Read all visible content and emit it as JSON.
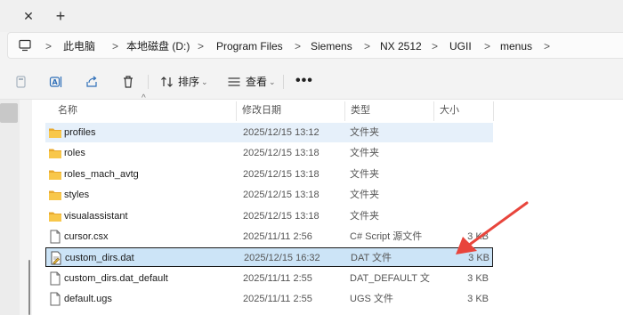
{
  "tabstrip": {
    "close_glyph": "✕",
    "new_tab_glyph": "+"
  },
  "address": {
    "crumbs": [
      "此电脑",
      "本地磁盘 (D:)",
      "Program Files",
      "Siemens",
      "NX 2512",
      "UGII",
      "menus"
    ],
    "separator": ">"
  },
  "toolbar": {
    "sort_label": "排序",
    "view_label": "查看",
    "more_label": "•••",
    "icons": [
      "copy-icon",
      "rename-icon",
      "share-icon",
      "delete-icon",
      "sort-icon",
      "view-icon",
      "more-icon"
    ]
  },
  "columns": {
    "name": "名称",
    "date": "修改日期",
    "type": "类型",
    "size": "大小"
  },
  "files": [
    {
      "name": "profiles",
      "date": "2025/12/15 13:12",
      "type": "文件夹",
      "size": "",
      "icon": "folder-icon",
      "state": "hover"
    },
    {
      "name": "roles",
      "date": "2025/12/15 13:18",
      "type": "文件夹",
      "size": "",
      "icon": "folder-icon",
      "state": ""
    },
    {
      "name": "roles_mach_avtg",
      "date": "2025/12/15 13:18",
      "type": "文件夹",
      "size": "",
      "icon": "folder-icon",
      "state": ""
    },
    {
      "name": "styles",
      "date": "2025/12/15 13:18",
      "type": "文件夹",
      "size": "",
      "icon": "folder-icon",
      "state": ""
    },
    {
      "name": "visualassistant",
      "date": "2025/12/15 13:18",
      "type": "文件夹",
      "size": "",
      "icon": "folder-icon",
      "state": ""
    },
    {
      "name": "cursor.csx",
      "date": "2025/11/11 2:56",
      "type": "C# Script 源文件",
      "size": "3 KB",
      "icon": "file-icon",
      "state": ""
    },
    {
      "name": "custom_dirs.dat",
      "date": "2025/12/15 16:32",
      "type": "DAT 文件",
      "size": "3 KB",
      "icon": "dat-file-icon",
      "state": "selected"
    },
    {
      "name": "custom_dirs.dat_default",
      "date": "2025/11/11 2:55",
      "type": "DAT_DEFAULT 文...",
      "size": "3 KB",
      "icon": "file-icon",
      "state": ""
    },
    {
      "name": "default.ugs",
      "date": "2025/11/11 2:55",
      "type": "UGS 文件",
      "size": "3 KB",
      "icon": "file-icon",
      "state": ""
    }
  ],
  "colors": {
    "folder": "#f8c74a",
    "selected_bg": "#cce4f7",
    "hover_bg": "#e6f0fa",
    "arrow": "#e8453c"
  }
}
